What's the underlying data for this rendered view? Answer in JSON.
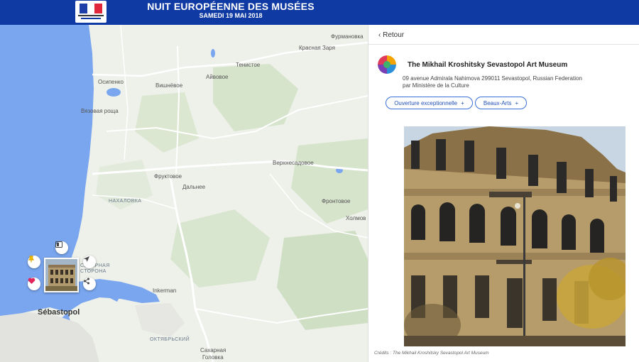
{
  "header": {
    "title": "NUIT EUROPÉENNE DES MUSÉES",
    "subtitle": "SAMEDI 19 MAI 2018",
    "logo_icon": "republique-francaise-logo-icon",
    "colors": {
      "header_bg": "#0f3aa3",
      "flag_blue": "#1f3fa8",
      "flag_white": "#ffffff",
      "flag_red": "#e0263a"
    }
  },
  "map": {
    "colors": {
      "sea": "#7aa6ef",
      "land": "#eef0ea",
      "green": "#cfdfc4",
      "road": "#ffffff",
      "water": "#7aa6ef"
    },
    "places": [
      {
        "name": "Фурмановка",
        "style": "normal"
      },
      {
        "name": "Красная Заря",
        "style": "normal"
      },
      {
        "name": "Тенистое",
        "style": "normal"
      },
      {
        "name": "Осипенко",
        "style": "normal"
      },
      {
        "name": "Айвовое",
        "style": "normal"
      },
      {
        "name": "Вишнёвое",
        "style": "normal"
      },
      {
        "name": "Вязовая роща",
        "style": "normal"
      },
      {
        "name": "Верхнесадовое",
        "style": "normal"
      },
      {
        "name": "Фруктовое",
        "style": "normal"
      },
      {
        "name": "Дальнее",
        "style": "normal"
      },
      {
        "name": "НАХАЛОВКА",
        "style": "small-caps"
      },
      {
        "name": "Фронтовое",
        "style": "normal"
      },
      {
        "name": "Холмов",
        "style": "normal"
      },
      {
        "name": "СЕВЕРНАЯ",
        "style": "small-caps"
      },
      {
        "name": "СТОРОНА",
        "style": "small-caps"
      },
      {
        "name": "Inkerman",
        "style": "normal"
      },
      {
        "name": "Sébastopol",
        "style": "city"
      },
      {
        "name": "ОКТЯБРЬСКИЙ",
        "style": "small-caps"
      },
      {
        "name": "Сахарная",
        "style": "normal"
      },
      {
        "name": "Головка",
        "style": "normal"
      }
    ],
    "buttons": {
      "pin_icon": "pushpin-icon",
      "favorite_icon": "heart-icon",
      "gallery_icon": "image-icon",
      "locate_icon": "navigation-arrow-icon",
      "share_icon": "share-icon"
    }
  },
  "panel": {
    "back_label": "Retour",
    "museum_name": "The Mikhail Kroshitsky Sevastopol Art Museum",
    "address": "09 avenue Admirala Nahimova 299011 Sevastopol, Russian Federation",
    "by_prefix": "par",
    "organizer": "Ministère de la Culture",
    "tags": [
      {
        "label": "Ouverture exceptionnelle",
        "icon": "+"
      },
      {
        "label": "Beaux-Arts",
        "icon": "+"
      }
    ],
    "credits": "Crédits : The Mikhail Kroshitsky Sevastopol Art Museum",
    "colors": {
      "accent": "#3a6fd8",
      "text": "#222222"
    }
  }
}
